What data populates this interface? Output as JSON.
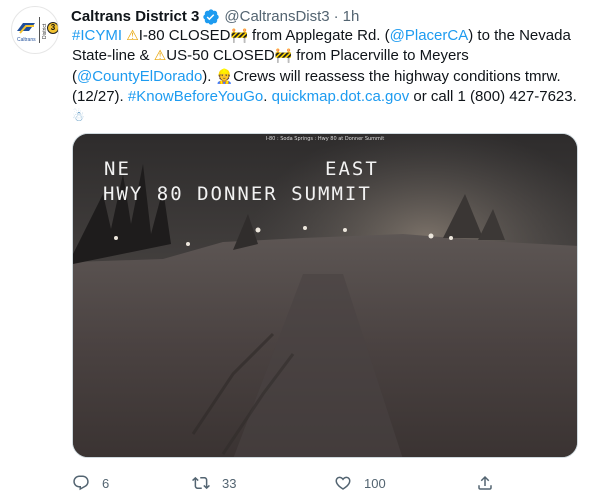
{
  "author": {
    "name": "Caltrans District 3",
    "handle": "@CaltransDist3",
    "separator": "·",
    "time": "1h",
    "avatar": {
      "logo_text": "Caltrans",
      "district_word": "District",
      "district_number": "3"
    }
  },
  "tweet": {
    "t01": "#ICYMI",
    "t02": " ",
    "t03": "⚠",
    "t04": "I-80 CLOSED",
    "t05": "🚧",
    "t06": " from Applegate Rd. (",
    "t07": "@PlacerCA",
    "t08": ") to the Nevada State-line & ",
    "t09": "⚠",
    "t10": "US-50 CLOSED",
    "t11": "🚧",
    "t12": " from Placerville to Meyers (",
    "t13": "@CountyElDorado",
    "t14": "). ",
    "t15": "👷",
    "t16": "Crews will reassess the highway conditions tmrw. (12/27). ",
    "t17": "#KnowBeforeYouGo",
    "t18": ". ",
    "t19": "quickmap.dot.ca.gov",
    "t20": " or call 1 (800) 427-7623.",
    "t21": "☃"
  },
  "media": {
    "camera_header": "I-80 : Soda Springs : Hwy 80 at Donner Summit",
    "overlay_line1_left": "NE",
    "overlay_line1_right": "EAST",
    "overlay_line2": "HWY 80 DONNER SUMMIT"
  },
  "actions": {
    "reply_count": "6",
    "retweet_count": "33",
    "like_count": "100"
  },
  "icons": {
    "reply": "reply-icon",
    "retweet": "retweet-icon",
    "like": "heart-icon",
    "share": "share-icon",
    "verified": "verified-badge-icon"
  },
  "colors": {
    "link": "#1d9bf0",
    "secondary_text": "#536471",
    "primary_text": "#0f1419"
  }
}
